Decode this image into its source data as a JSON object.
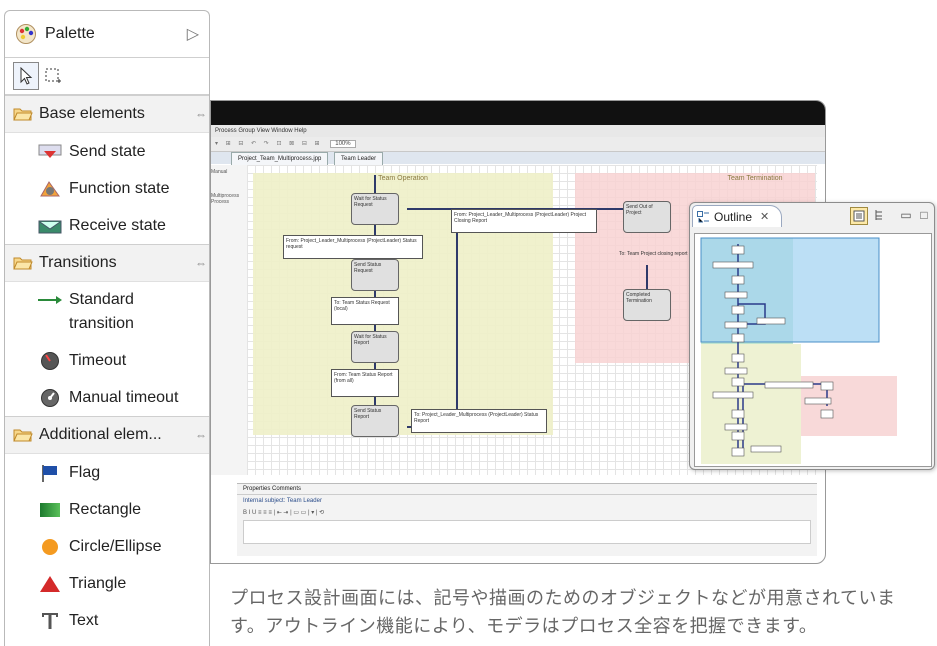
{
  "palette": {
    "title": "Palette",
    "groups": [
      {
        "label": "Base elements",
        "items": [
          {
            "label": "Send state",
            "icon": "send-state-icon"
          },
          {
            "label": "Function state",
            "icon": "function-state-icon"
          },
          {
            "label": "Receive state",
            "icon": "receive-state-icon"
          }
        ]
      },
      {
        "label": "Transitions",
        "items": [
          {
            "label": "Standard",
            "label2": "transition",
            "icon": "standard-transition-icon"
          },
          {
            "label": "Timeout",
            "icon": "timeout-icon"
          },
          {
            "label": "Manual timeout",
            "icon": "manual-timeout-icon"
          }
        ]
      },
      {
        "label": "Additional elem...",
        "items": [
          {
            "label": "Flag",
            "icon": "flag-icon"
          },
          {
            "label": "Rectangle",
            "icon": "rectangle-icon"
          },
          {
            "label": "Circle/Ellipse",
            "icon": "circle-ellipse-icon"
          },
          {
            "label": "Triangle",
            "icon": "triangle-icon"
          },
          {
            "label": "Text",
            "icon": "text-icon"
          }
        ]
      }
    ]
  },
  "editor": {
    "menu": "Process Group   View   Window   Help",
    "toolbar": "100%",
    "tabs": [
      "Project_Team_Multiprocess.jpp",
      "Team Leader"
    ],
    "sidebar_text": [
      "Manual",
      "Multiprocess",
      "Process"
    ],
    "lanes": [
      "Team Operation",
      "Team Termination"
    ],
    "states": [
      "Wait for Status Request",
      "Send Status Request",
      "Wait for Status Report",
      "Send Status Report",
      "Send Out of Project",
      "Completed Termination"
    ],
    "notes": [
      "From: Project_Leader_Multiprocess (ProjectLeader) Status request",
      "From: Project_Leader_Multiprocess (ProjectLeader) Project Closing Report",
      "To: Team Status Request (local)",
      "From: Team Status Report (from all)",
      "To: Project_Leader_Multiprocess (ProjectLeader) Status Report",
      "To: Team Project closing report (to all)"
    ],
    "bottom_tabs": "Properties  Comments",
    "subject": "Internal subject: Team Leader"
  },
  "outline": {
    "title": "Outline",
    "colors": {
      "highlight": "#a6d4f2",
      "lane_green": "#e6efcf",
      "lane_red": "#f8d4d4"
    }
  },
  "caption": "プロセス設計画面には、記号や描画のためのオブジェクトなどが用意されています。アウトライン機能により、モデラはプロセス全容を把握できます。"
}
